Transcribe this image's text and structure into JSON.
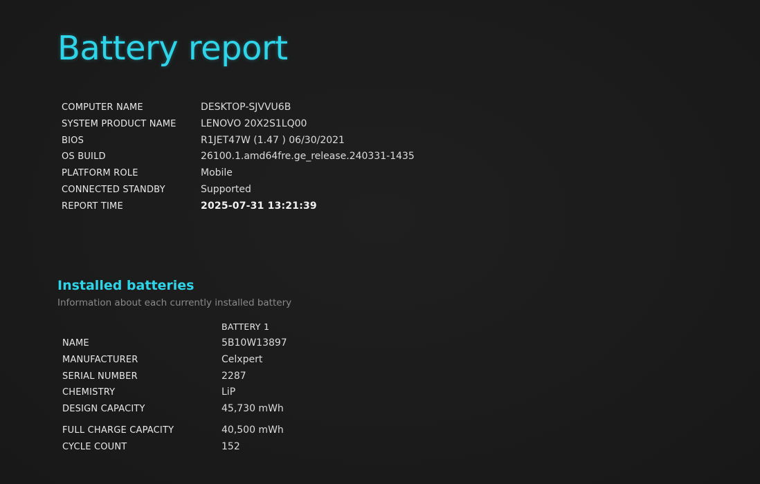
{
  "report": {
    "title": "Battery report"
  },
  "system": {
    "rows": [
      {
        "label": "COMPUTER NAME",
        "value": "DESKTOP-SJVVU6B"
      },
      {
        "label": "SYSTEM PRODUCT NAME",
        "value": "LENOVO 20X2S1LQ00"
      },
      {
        "label": "BIOS",
        "value": "R1JET47W (1.47 ) 06/30/2021"
      },
      {
        "label": "OS BUILD",
        "value": "26100.1.amd64fre.ge_release.240331-1435"
      },
      {
        "label": "PLATFORM ROLE",
        "value": "Mobile"
      },
      {
        "label": "CONNECTED STANDBY",
        "value": "Supported"
      },
      {
        "label": "REPORT TIME",
        "value": "2025-07-31  13:21:39"
      }
    ]
  },
  "installed_batteries": {
    "title": "Installed batteries",
    "subtitle": "Information about each currently installed battery",
    "column_header": "BATTERY 1",
    "rows": [
      {
        "label": "NAME",
        "value": "5B10W13897"
      },
      {
        "label": "MANUFACTURER",
        "value": "Celxpert"
      },
      {
        "label": "SERIAL NUMBER",
        "value": "2287"
      },
      {
        "label": "CHEMISTRY",
        "value": "LiP"
      },
      {
        "label": "DESIGN CAPACITY",
        "value": "45,730 mWh"
      },
      {
        "label": "FULL CHARGE CAPACITY",
        "value": "40,500 mWh"
      },
      {
        "label": "CYCLE COUNT",
        "value": "152"
      }
    ]
  },
  "colors": {
    "accent": "#2fd4e8",
    "background": "#1b1b1b",
    "subtitle": "#8a8a8a"
  }
}
